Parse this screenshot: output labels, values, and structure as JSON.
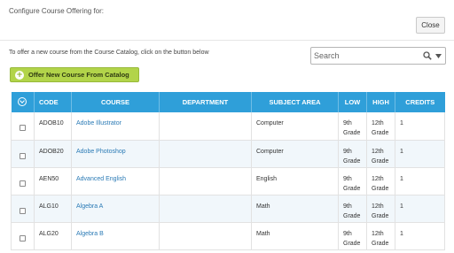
{
  "header": {
    "title": "Configure Course Offering for:",
    "close_label": "Close"
  },
  "toolbar": {
    "instructions": "To offer a new course from the Course Catalog, click on the button below",
    "search_placeholder": "Search",
    "offer_button_label": "Offer New Course From Catalog"
  },
  "table": {
    "columns": [
      "CODE",
      "COURSE",
      "DEPARTMENT",
      "SUBJECT AREA",
      "LOW",
      "HIGH",
      "CREDITS"
    ],
    "rows": [
      {
        "code": "ADOB10",
        "course": "Adobe Illustrator",
        "department": "",
        "subject": "Computer",
        "low": "9th Grade",
        "high": "12th Grade",
        "credits": "1"
      },
      {
        "code": "ADOB20",
        "course": "Adobe Photoshop",
        "department": "",
        "subject": "Computer",
        "low": "9th Grade",
        "high": "12th Grade",
        "credits": "1"
      },
      {
        "code": "AEN50",
        "course": "Advanced English",
        "department": "",
        "subject": "English",
        "low": "9th Grade",
        "high": "12th Grade",
        "credits": "1"
      },
      {
        "code": "ALG10",
        "course": "Algebra A",
        "department": "",
        "subject": "Math",
        "low": "9th Grade",
        "high": "12th Grade",
        "credits": "1"
      },
      {
        "code": "ALG20",
        "course": "Algebra B",
        "department": "",
        "subject": "Math",
        "low": "9th Grade",
        "high": "12th Grade",
        "credits": "1"
      }
    ]
  },
  "icons": {
    "select_all": "chevron-circle-down-icon",
    "search": "search-icon",
    "search_dropdown": "chevron-down-icon",
    "offer": "plus-circle-icon"
  },
  "colors": {
    "table_header": "#2f9fd9",
    "offer_button": "#b2d44a",
    "link": "#2a7ab5",
    "row_stripe": "#f1f7fb"
  }
}
